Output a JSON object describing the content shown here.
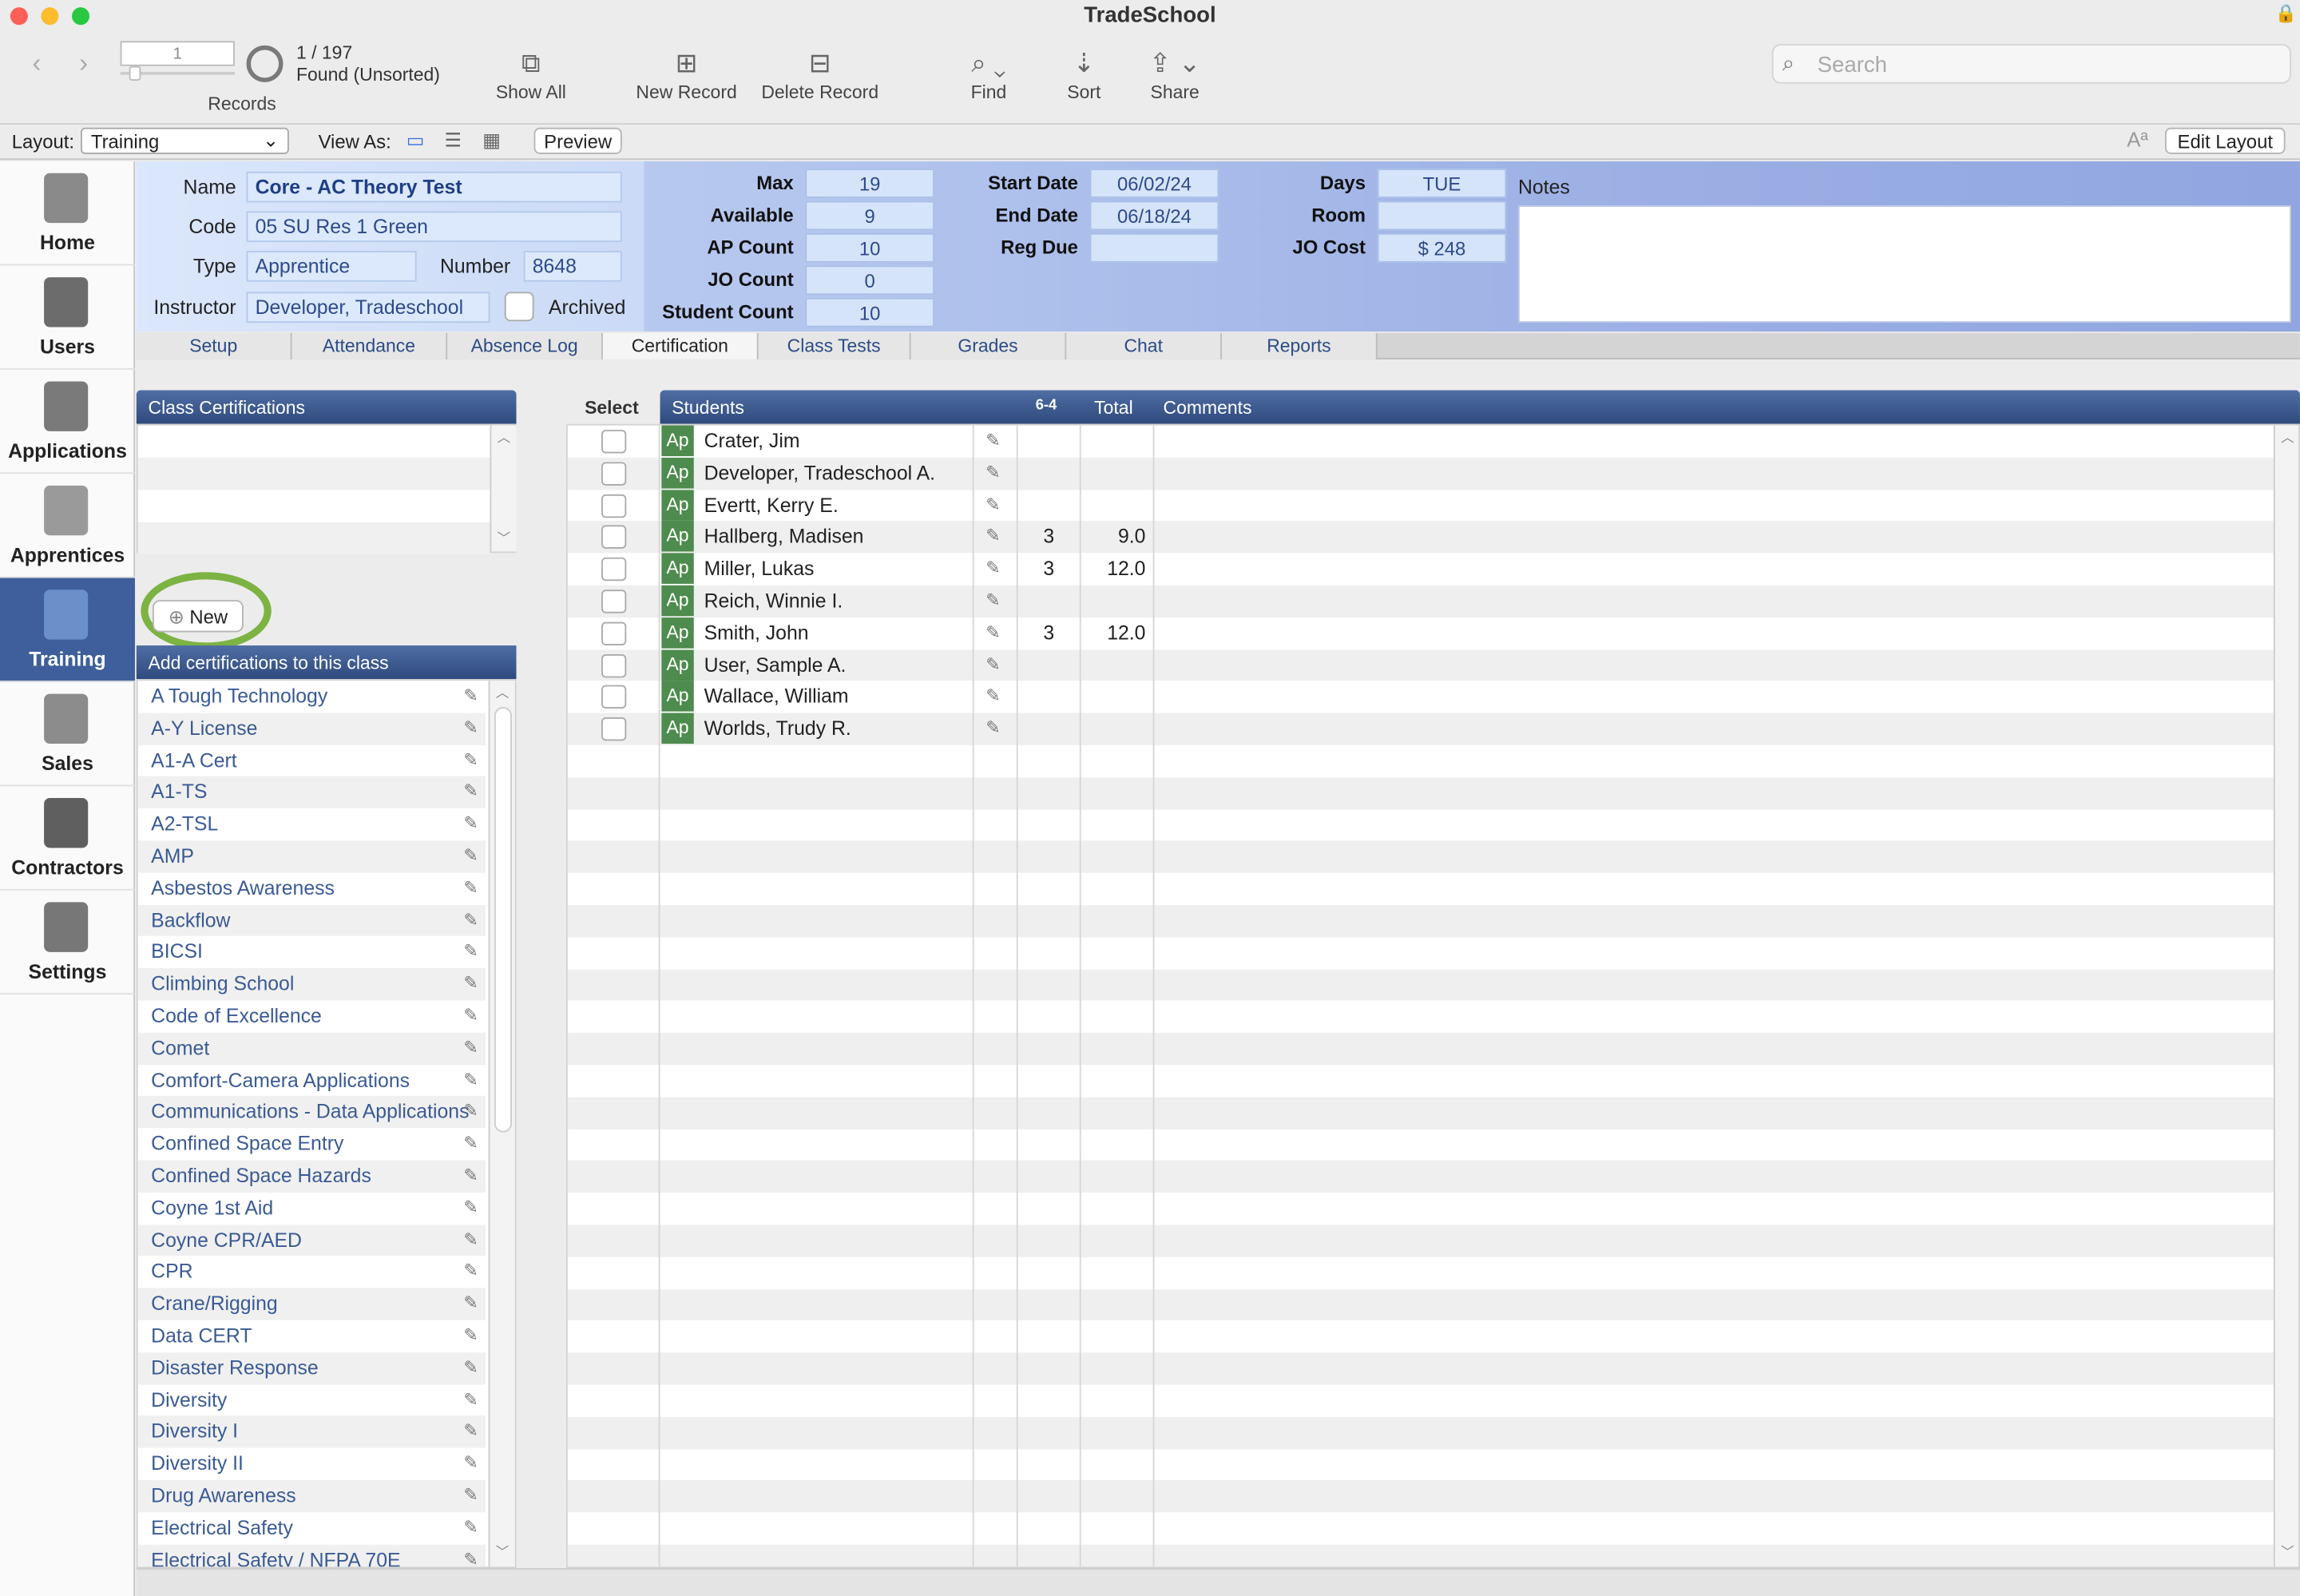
{
  "window": {
    "title": "TradeSchool"
  },
  "toolbar": {
    "record_number": "1",
    "found_count": "1 / 197",
    "found_status": "Found (Unsorted)",
    "records_label": "Records",
    "show_all": "Show All",
    "new_record": "New Record",
    "delete_record": "Delete Record",
    "find": "Find",
    "sort": "Sort",
    "share": "Share",
    "search_placeholder": "Search"
  },
  "layoutbar": {
    "layout_label": "Layout:",
    "layout_value": "Training",
    "view_as": "View As:",
    "preview": "Preview",
    "edit_layout": "Edit Layout"
  },
  "sidebar": {
    "items": [
      {
        "label": "Home",
        "icon": "home-icon"
      },
      {
        "label": "Users",
        "icon": "address-book-icon"
      },
      {
        "label": "Applications",
        "icon": "clipboard-icon"
      },
      {
        "label": "Apprentices",
        "icon": "id-card-icon"
      },
      {
        "label": "Training",
        "icon": "certificate-icon"
      },
      {
        "label": "Sales",
        "icon": "basket-icon"
      },
      {
        "label": "Contractors",
        "icon": "briefcase-icon"
      },
      {
        "label": "Settings",
        "icon": "wrench-icon"
      }
    ]
  },
  "record": {
    "name_label": "Name",
    "name": "Core - AC Theory Test",
    "code_label": "Code",
    "code": "05 SU Res 1  Green",
    "type_label": "Type",
    "type": "Apprentice",
    "number_label": "Number",
    "number": "8648",
    "instructor_label": "Instructor",
    "instructor": "Developer, Tradeschool",
    "archived_label": "Archived",
    "max_label": "Max",
    "max": "19",
    "available_label": "Available",
    "available": "9",
    "ap_count_label": "AP Count",
    "ap_count": "10",
    "jo_count_label": "JO Count",
    "jo_count": "0",
    "student_count_label": "Student Count",
    "student_count": "10",
    "start_date_label": "Start Date",
    "start_date": "06/02/24",
    "end_date_label": "End Date",
    "end_date": "06/18/24",
    "reg_due_label": "Reg Due",
    "reg_due": "",
    "days_label": "Days",
    "days": "TUE",
    "room_label": "Room",
    "room": "",
    "jo_cost_label": "JO Cost",
    "jo_cost": "$ 248",
    "notes_label": "Notes"
  },
  "tabs": [
    "Setup",
    "Attendance",
    "Absence Log",
    "Certification",
    "Class Tests",
    "Grades",
    "Chat",
    "Reports"
  ],
  "certifications": {
    "title": "Class Certifications",
    "new_button": "New",
    "add_title": "Add certifications to this class",
    "list": [
      "A Tough Technology",
      "A-Y License",
      "A1-A Cert",
      "A1-TS",
      "A2-TSL",
      "AMP",
      "Asbestos Awareness",
      "Backflow",
      "BICSI",
      "Climbing School",
      "Code of Excellence",
      "Comet",
      "Comfort-Camera Applications",
      "Communications - Data Applications",
      "Confined Space Entry",
      "Confined Space Hazards",
      "Coyne 1st Aid",
      "Coyne CPR/AED",
      "CPR",
      "Crane/Rigging",
      "Data CERT",
      "Disaster Response",
      "Diversity",
      "Diversity I",
      "Diversity II",
      "Drug Awareness",
      "Electrical Safety",
      "Electrical Safety / NFPA 70E"
    ]
  },
  "students": {
    "headers": {
      "select": "Select",
      "students": "Students",
      "score": "6-4",
      "total": "Total",
      "comments": "Comments"
    },
    "badge": "Ap",
    "rows": [
      {
        "name": "Crater, Jim",
        "score": "",
        "total": ""
      },
      {
        "name": "Developer, Tradeschool  A.",
        "score": "",
        "total": ""
      },
      {
        "name": "Evertt, Kerry  E.",
        "score": "",
        "total": ""
      },
      {
        "name": "Hallberg, Madisen",
        "score": "3",
        "total": "9.0"
      },
      {
        "name": "Miller, Lukas",
        "score": "3",
        "total": "12.0"
      },
      {
        "name": "Reich, Winnie  I.",
        "score": "",
        "total": ""
      },
      {
        "name": "Smith, John",
        "score": "3",
        "total": "12.0"
      },
      {
        "name": "User, Sample  A.",
        "score": "",
        "total": ""
      },
      {
        "name": "Wallace, William",
        "score": "",
        "total": ""
      },
      {
        "name": "Worlds, Trudy  R.",
        "score": "",
        "total": ""
      }
    ]
  },
  "colors": {
    "accent": "#3e5f9b",
    "badge": "#4e8b4e",
    "highlight_ring": "#7cb342"
  }
}
